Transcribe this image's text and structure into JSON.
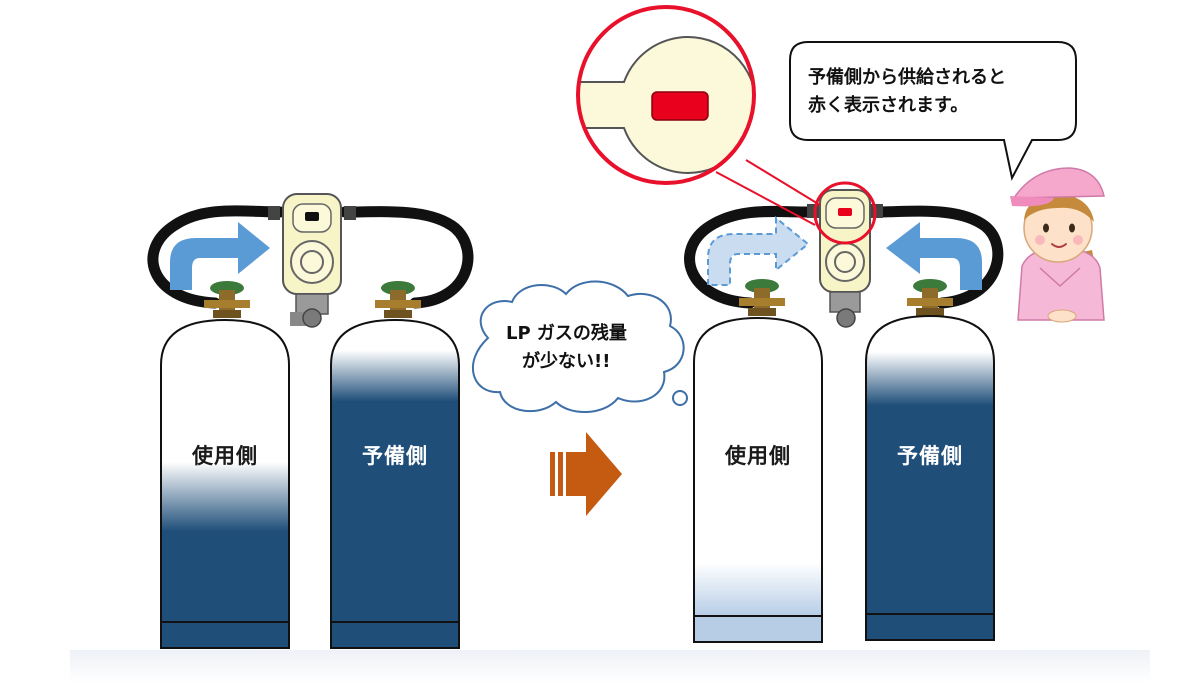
{
  "left_scene": {
    "cylinder_in_use_label": "使用側",
    "cylinder_reserve_label": "予備側"
  },
  "right_scene": {
    "cylinder_in_use_label": "使用側",
    "cylinder_reserve_label": "予備側"
  },
  "thought_bubble": {
    "line1": "LP ガスの残量",
    "line2": "が少ない!!"
  },
  "speech_bubble": {
    "line1": "予備側から供給されると",
    "line2": "赤く表示されます。"
  },
  "colors": {
    "gas_fill": "#1f4e79",
    "indicator_red": "#e8001c",
    "zoom_circle": "#e8102a",
    "transition_arrow": "#c55a11",
    "flow_arrow": "#5b9bd5",
    "regulator_body": "#f7f5c8",
    "valve_green": "#3c7a3c"
  },
  "icons": {
    "flow_arrow": "curved-arrow-icon",
    "transition": "right-arrow-icon",
    "indicator": "red-indicator-icon",
    "staff": "woman-staff-icon"
  }
}
